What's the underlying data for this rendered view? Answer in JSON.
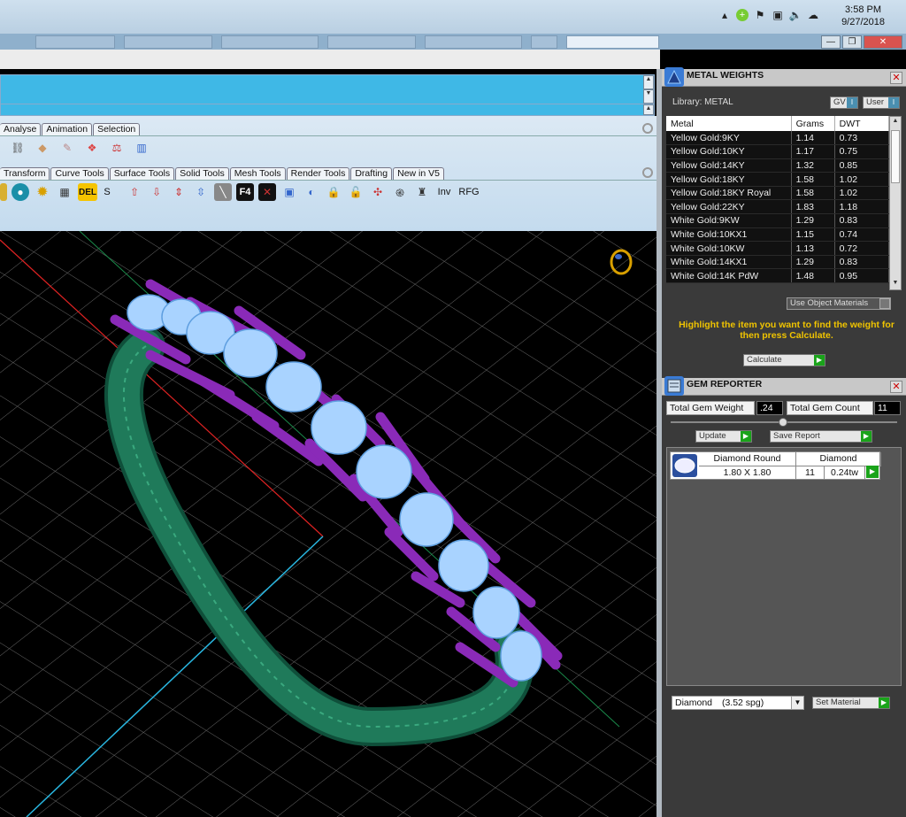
{
  "taskbar": {
    "time": "3:58 PM",
    "date": "9/27/2018"
  },
  "menu": {
    "tabs_top": [
      "Analyse",
      "Animation",
      "Selection"
    ],
    "tabs_bottom": [
      "Transform",
      "Curve Tools",
      "Surface Tools",
      "Solid Tools",
      "Mesh Tools",
      "Render Tools",
      "Drafting",
      "New in V5"
    ],
    "toolbar_text": {
      "s": "S",
      "inv": "Inv",
      "rfg": "RFG",
      "f4": "F4",
      "del": "DEL"
    }
  },
  "metal_weights": {
    "title": "METAL WEIGHTS",
    "library_label": "Library: METAL",
    "gv_label": "GV",
    "user_label": "User",
    "columns": [
      "Metal",
      "Grams",
      "DWT"
    ],
    "rows": [
      [
        "Yellow Gold:9KY",
        "1.14",
        "0.73"
      ],
      [
        "Yellow Gold:10KY",
        "1.17",
        "0.75"
      ],
      [
        "Yellow Gold:14KY",
        "1.32",
        "0.85"
      ],
      [
        "Yellow Gold:18KY",
        "1.58",
        "1.02"
      ],
      [
        "Yellow Gold:18KY Royal",
        "1.58",
        "1.02"
      ],
      [
        "Yellow Gold:22KY",
        "1.83",
        "1.18"
      ],
      [
        "White Gold:9KW",
        "1.29",
        "0.83"
      ],
      [
        "White Gold:10KX1",
        "1.15",
        "0.74"
      ],
      [
        "White Gold:10KW",
        "1.13",
        "0.72"
      ],
      [
        "White Gold:14KX1",
        "1.29",
        "0.83"
      ],
      [
        "White Gold:14K PdW",
        "1.48",
        "0.95"
      ]
    ],
    "use_object_materials": "Use Object Materials",
    "hint": "Highlight the item you want to find the weight for then press Calculate.",
    "calculate_label": "Calculate"
  },
  "gem_reporter": {
    "title": "GEM REPORTER",
    "total_weight_label": "Total Gem Weight",
    "total_weight_value": ".24",
    "total_count_label": "Total Gem Count",
    "total_count_value": "11",
    "update_label": "Update",
    "save_report_label": "Save Report",
    "gem": {
      "cut": "Diamond Round",
      "material": "Diamond",
      "size": "1.80 X 1.80",
      "count": "11",
      "weight": "0.24tw"
    },
    "material_select": "Diamond",
    "material_spg": "(3.52 spg)",
    "set_material_label": "Set Material"
  },
  "colors": {
    "band": "#1f7a5a",
    "prongs": "#8a2ab8",
    "gems": "#a9d3ff",
    "accent_cyan": "#3fb8e6",
    "hint_yellow": "#f0c400"
  }
}
